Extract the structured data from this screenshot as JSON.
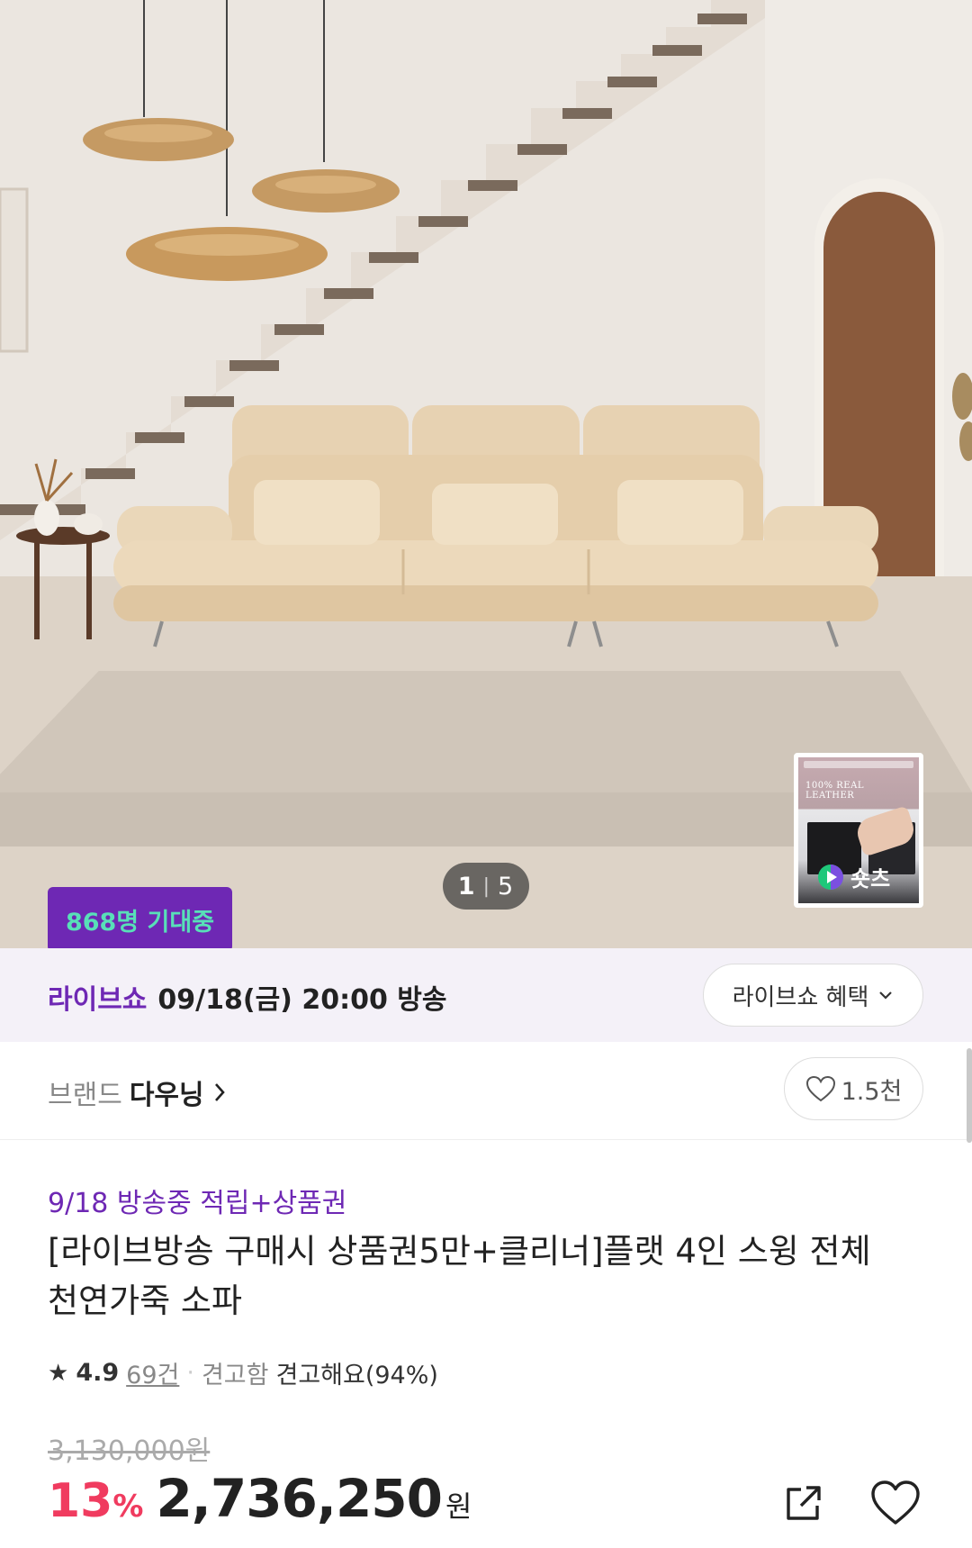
{
  "hero": {
    "counter_current": "1",
    "counter_total": "5",
    "shorts_caption": "100% REAL LEATHER",
    "shorts_label": "숏츠",
    "badge": "868명 기대중"
  },
  "live": {
    "brand_label": "라이브쇼",
    "schedule": "09/18(금) 20:00 방송",
    "benefit_button": "라이브쇼 혜택"
  },
  "brand": {
    "label": "브랜드",
    "name": "다우닝",
    "like_count": "1.5천"
  },
  "product": {
    "promo": "9/18 방송중 적립+상품권",
    "title": "[라이브방송 구매시 상품권5만+클리너]플랫 4인 스윙 전체 천연가죽 소파",
    "rating": "4.9",
    "review_count": "69건",
    "attr_label": "견고함",
    "attr_value": "견고해요(94%)",
    "original_price": "3,130,000원",
    "discount_value": "13",
    "discount_unit": "%",
    "price": "2,736,250",
    "price_unit": "원"
  },
  "colors": {
    "brand_purple": "#6e28b4",
    "badge_text": "#58e0b8",
    "discount_red": "#f03b5f"
  }
}
